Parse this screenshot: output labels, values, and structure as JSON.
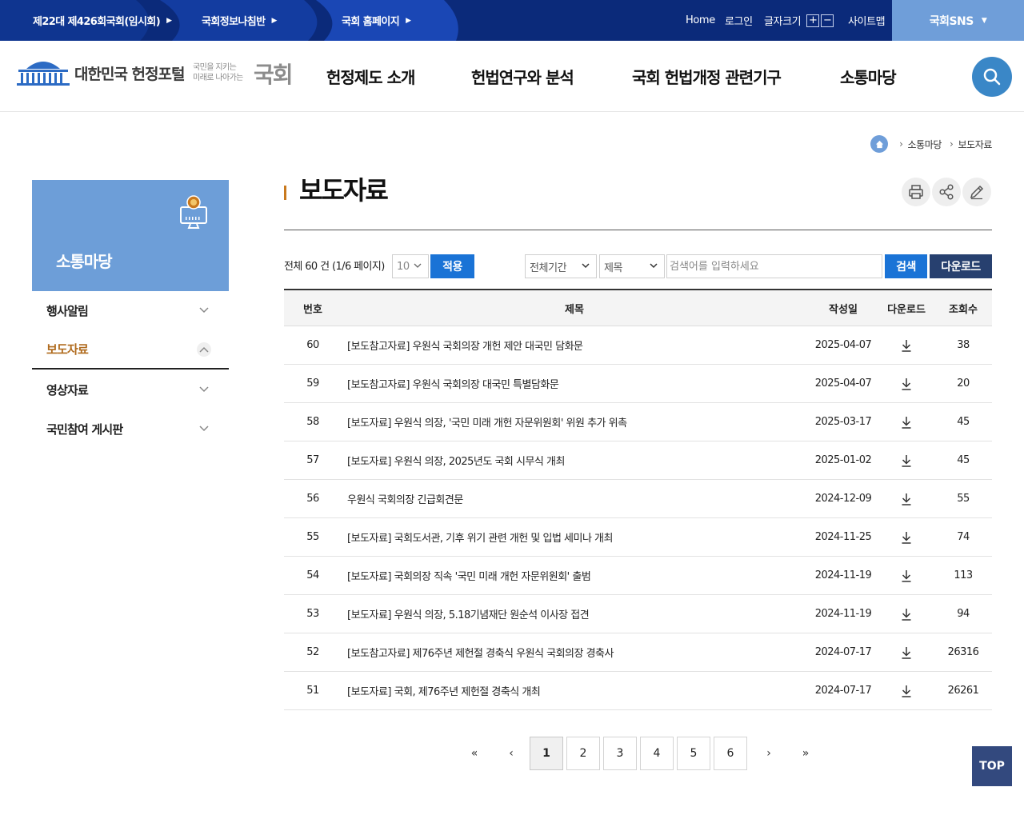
{
  "topbar": {
    "links": [
      {
        "label": "제22대 제426회국회(임시회)"
      },
      {
        "label": "국회정보나침반"
      },
      {
        "label": "국회 홈페이지"
      }
    ],
    "util": {
      "home": "Home",
      "login": "로그인",
      "font_size": "글자크기",
      "font_plus": "+",
      "font_minus": "−",
      "sitemap": "사이트맵"
    },
    "sns": "국회SNS"
  },
  "header": {
    "logo_text": "대한민국 헌정포털",
    "logo_sub_1": "국민을 지키는",
    "logo_sub_2": "미래로 나아가는",
    "logo_big": "국회",
    "nav": [
      "헌정제도 소개",
      "헌법연구와 분석",
      "국회 헌법개정 관련기구",
      "소통마당"
    ]
  },
  "breadcrumb": [
    "소통마당",
    "보도자료"
  ],
  "sidebar": {
    "title": "소통마당",
    "items": [
      {
        "label": "행사알림"
      },
      {
        "label": "보도자료",
        "active": true
      },
      {
        "label": "영상자료"
      },
      {
        "label": "국민참여 게시판"
      }
    ]
  },
  "main": {
    "title": "보도자료",
    "total_text": "전체 60 건 (1/6 페이지)",
    "page_size": "10",
    "apply_label": "적용",
    "period_select": "전체기간",
    "field_select": "제목",
    "search_placeholder": "검색어를 입력하세요",
    "search_label": "검색",
    "download_label": "다운로드"
  },
  "table": {
    "headers": {
      "num": "번호",
      "title": "제목",
      "date": "작성일",
      "download": "다운로드",
      "views": "조회수"
    },
    "rows": [
      {
        "num": "60",
        "title": "[보도참고자료] 우원식 국회의장 개헌 제안 대국민 담화문",
        "date": "2025-04-07",
        "views": "38"
      },
      {
        "num": "59",
        "title": "[보도참고자료] 우원식 국회의장 대국민 특별담화문",
        "date": "2025-04-07",
        "views": "20"
      },
      {
        "num": "58",
        "title": "[보도자료] 우원식 의장, '국민 미래 개헌 자문위원회' 위원 추가 위촉",
        "date": "2025-03-17",
        "views": "45"
      },
      {
        "num": "57",
        "title": "[보도자료] 우원식 의장, 2025년도 국회 시무식 개최",
        "date": "2025-01-02",
        "views": "45"
      },
      {
        "num": "56",
        "title": "우원식 국회의장 긴급회견문",
        "date": "2024-12-09",
        "views": "55"
      },
      {
        "num": "55",
        "title": "[보도자료] 국회도서관, 기후 위기 관련 개헌 및 입법 세미나 개최",
        "date": "2024-11-25",
        "views": "74"
      },
      {
        "num": "54",
        "title": "[보도자료] 국회의장 직속 '국민 미래 개헌 자문위원회' 출범",
        "date": "2024-11-19",
        "views": "113"
      },
      {
        "num": "53",
        "title": "[보도자료] 우원식 의장, 5.18기념재단 원순석 이사장 접견",
        "date": "2024-11-19",
        "views": "94"
      },
      {
        "num": "52",
        "title": "[보도참고자료] 제76주년 제헌절 경축식 우원식 국회의장 경축사",
        "date": "2024-07-17",
        "views": "26316"
      },
      {
        "num": "51",
        "title": "[보도자료] 국회, 제76주년 제헌절 경축식 개최",
        "date": "2024-07-17",
        "views": "26261"
      }
    ]
  },
  "pagination": {
    "first": "«",
    "prev": "‹",
    "pages": [
      "1",
      "2",
      "3",
      "4",
      "5",
      "6"
    ],
    "current": "1",
    "next": "›",
    "last": "»"
  },
  "top_button": "TOP",
  "colors": {
    "topbar": "#0b2a7a",
    "accent_blue": "#1a73d6",
    "navy_button": "#27406f",
    "sidebar": "#6d9ed8",
    "active_text": "#b06b1e"
  }
}
